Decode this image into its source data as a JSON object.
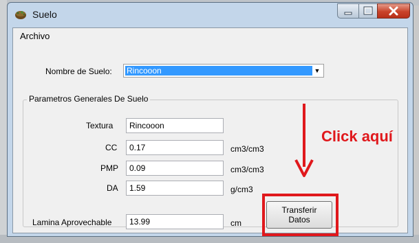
{
  "window": {
    "title": "Suelo",
    "icon": "soil-app-icon"
  },
  "menu": {
    "archivo": "Archivo"
  },
  "soil": {
    "label": "Nombre de Suelo:",
    "value": "Rincooon"
  },
  "group": {
    "title": "Parametros Generales De Suelo",
    "textura": {
      "label": "Textura",
      "value": "Rincooon"
    },
    "cc": {
      "label": "CC",
      "value": "0.17",
      "unit": "cm3/cm3"
    },
    "pmp": {
      "label": "PMP",
      "value": "0.09",
      "unit": "cm3/cm3"
    },
    "da": {
      "label": "DA",
      "value": "1.59",
      "unit": "g/cm3"
    },
    "lamina": {
      "label": "Lamina Aprovechable",
      "value": "13.99",
      "unit": "cm"
    }
  },
  "transfer_button": {
    "line1": "Transferir",
    "line2": "Datos"
  },
  "annotation": {
    "text": "Click aquí",
    "color": "#e0181c"
  },
  "colors": {
    "selection": "#3399ff",
    "close_button": "#c9432a",
    "highlight": "#e0181c"
  }
}
